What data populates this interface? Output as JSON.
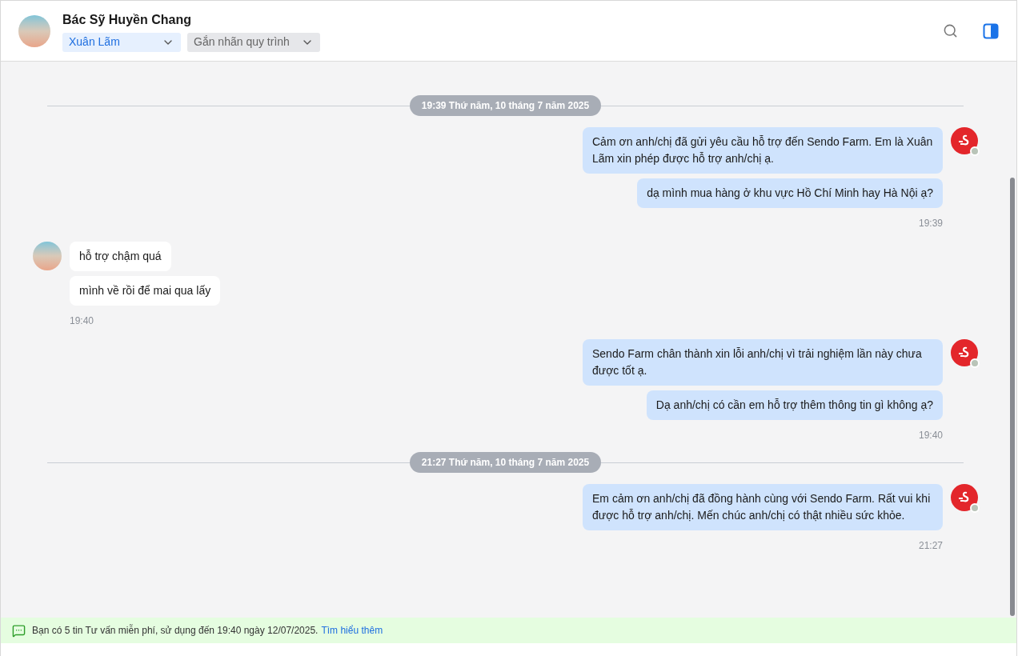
{
  "header": {
    "name": "Bác Sỹ Huyền Chang",
    "assignee": "Xuân Lãm",
    "tag_placeholder": "Gắn nhãn quy trình"
  },
  "thread": [
    {
      "kind": "divider",
      "label": "19:39 Thứ năm, 10 tháng 7 năm 2025"
    },
    {
      "kind": "agent",
      "bubbles": [
        "Cảm ơn anh/chị đã gửi yêu cầu hỗ trợ đến Sendo Farm. Em là Xuân Lãm xin phép được hỗ trợ anh/chị ạ.",
        "dạ mình mua hàng ở khu vực Hồ Chí Minh hay Hà Nội ạ?"
      ],
      "time": "19:39"
    },
    {
      "kind": "customer",
      "bubbles": [
        "hỗ trợ chậm quá",
        "mình về rồi để mai qua lấy"
      ],
      "time": "19:40"
    },
    {
      "kind": "agent",
      "bubbles": [
        "Sendo Farm chân thành xin lỗi anh/chị vì trải nghiệm lần này chưa được tốt ạ.",
        "Dạ anh/chị có cần em hỗ trợ thêm thông tin gì không ạ?"
      ],
      "time": "19:40"
    },
    {
      "kind": "divider",
      "label": "21:27 Thứ năm, 10 tháng 7 năm 2025"
    },
    {
      "kind": "agent",
      "bubbles": [
        "Em cảm ơn anh/chị đã đồng hành cùng với Sendo Farm. Rất vui khi được hỗ trợ anh/chị. Mến chúc anh/chị có thật nhiều sức khỏe."
      ],
      "time": "21:27"
    }
  ],
  "notice": {
    "text": "Bạn có 5 tin Tư vấn miễn phí, sử dụng đến 19:40 ngày 12/07/2025.",
    "link": "Tìm hiểu thêm"
  }
}
